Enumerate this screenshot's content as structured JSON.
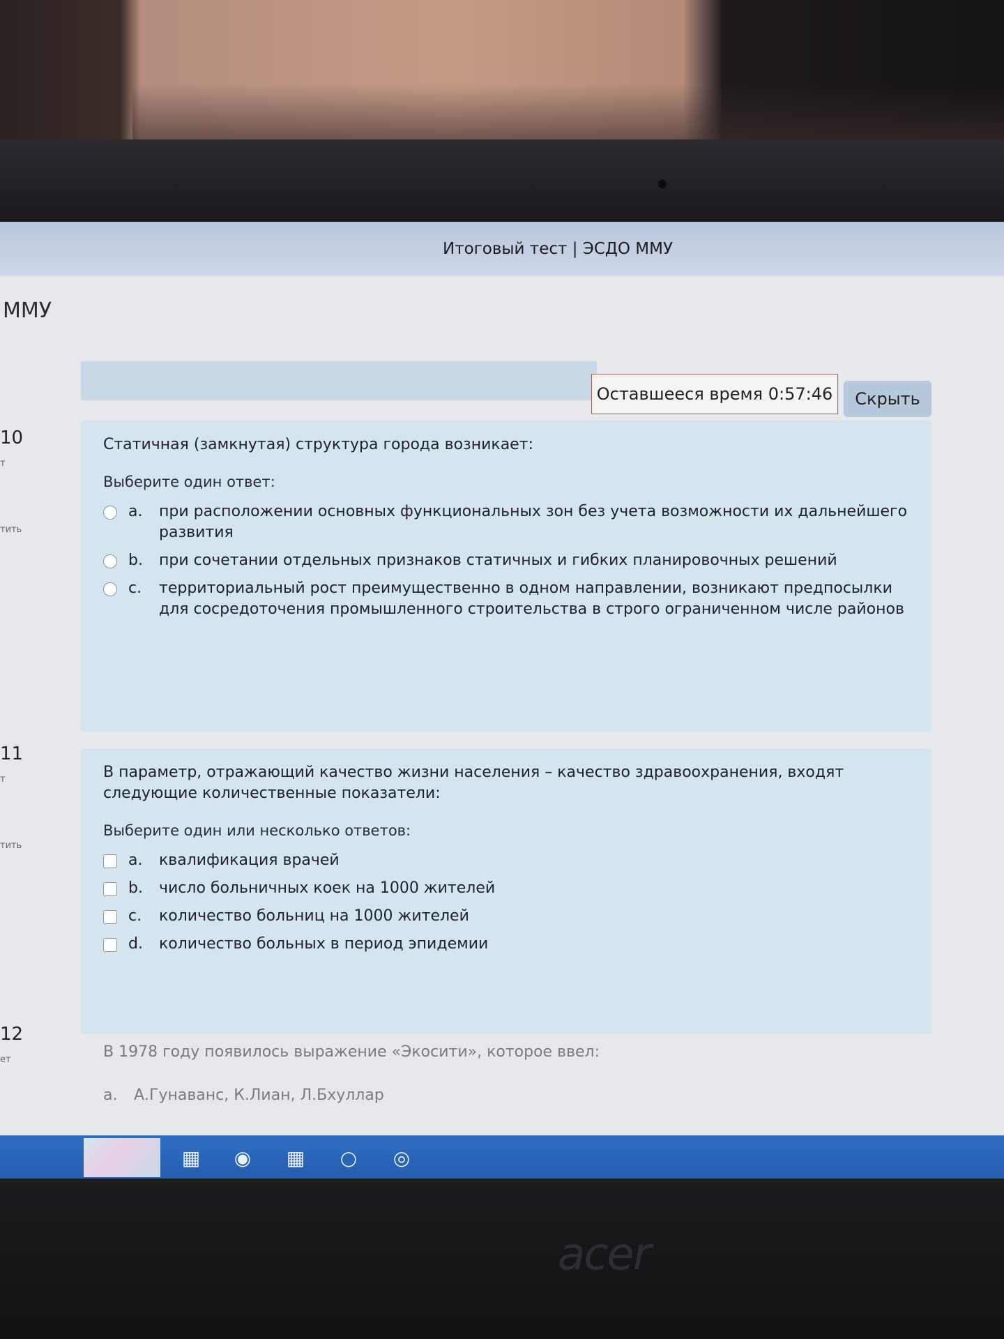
{
  "window": {
    "title": "Итоговый тест | ЭСДО ММУ"
  },
  "site": {
    "brand": "ММУ"
  },
  "timer": {
    "label": "Оставшееся время 0:57:46",
    "hide_label": "Скрыть"
  },
  "questions": [
    {
      "number": "10",
      "sub": "т",
      "flag": "тить",
      "text": "Статичная (замкнутая) структура города возникает:",
      "prompt": "Выберите один ответ:",
      "type": "radio",
      "answers": [
        {
          "letter": "a.",
          "text": "при расположении основных функциональных зон без учета возможности их дальнейшего развития"
        },
        {
          "letter": "b.",
          "text": "при сочетании отдельных признаков статичных и гибких планировочных решений"
        },
        {
          "letter": "c.",
          "text": "территориальный рост преимущественно в одном направлении, возникают предпосылки для сосредоточения промышленного строительства в строго ограниченном числе районов"
        }
      ]
    },
    {
      "number": "11",
      "sub": "т",
      "flag": "тить",
      "text": "В параметр, отражающий качество жизни населения – качество здравоохранения, входят следующие количественные показатели:",
      "prompt": "Выберите один или несколько ответов:",
      "type": "checkbox",
      "answers": [
        {
          "letter": "a.",
          "text": "квалификация врачей"
        },
        {
          "letter": "b.",
          "text": "число больничных коек на 1000 жителей"
        },
        {
          "letter": "c.",
          "text": "количество больниц на 1000 жителей"
        },
        {
          "letter": "d.",
          "text": "количество больных в период эпидемии"
        }
      ]
    },
    {
      "number": "12",
      "sub": "ет",
      "text": "В 1978 году появилось выражение «Экосити», которое ввел:",
      "answers": [
        {
          "letter": "a.",
          "text": "А.Гунаванс, К.Лиан, Л.Бхуллар"
        }
      ]
    }
  ],
  "device": {
    "logo": "acer"
  }
}
